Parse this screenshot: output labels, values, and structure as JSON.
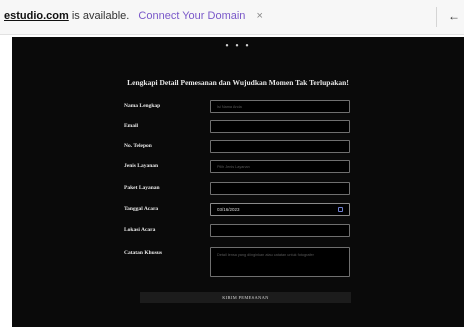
{
  "notification": {
    "domain": "estudio.com",
    "available_text": " is available.",
    "connect_label": "Connect Your Domain",
    "close_glyph": "×",
    "back_glyph": "←"
  },
  "page": {
    "dots": "• • •",
    "title": "Lengkapi Detail Pemesanan dan Wujudkan Momen Tak Terlupakan!"
  },
  "form": {
    "nama_label": "Nama Lengkap",
    "nama_placeholder": "Isi Nama Anda",
    "email_label": "Email",
    "email_value": "",
    "telepon_label": "No. Telepon",
    "telepon_value": "",
    "layanan_label": "Jenis Layanan",
    "layanan_placeholder": "Pilih Jenis Layanan",
    "paket_label": "Paket Layanan",
    "paket_value": "",
    "tanggal_label": "Tanggal Acara",
    "tanggal_value": "03/16/2023",
    "lokasi_label": "Lokasi Acara",
    "lokasi_value": "",
    "catatan_label": "Catatan Khusus",
    "catatan_placeholder": "Detail lensa yang diinginkan atau catatan untuk fotografer",
    "submit_label": "KIRIM PEMESANAN"
  },
  "colors": {
    "background": "#0a0a0a",
    "link": "#7a58c9",
    "calendar_icon": "#6f7fd0"
  }
}
